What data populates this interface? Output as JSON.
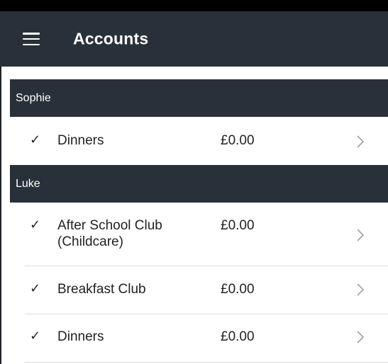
{
  "app_bar": {
    "title": "Accounts",
    "menu_icon": "hamburger-menu-icon",
    "background": "#283139"
  },
  "groups": [
    {
      "name": "Sophie",
      "accounts": [
        {
          "check": "✓",
          "name": "Dinners",
          "amount": "£0.00"
        }
      ]
    },
    {
      "name": "Luke",
      "accounts": [
        {
          "check": "✓",
          "name": "After School Club",
          "name_line2": "(Childcare)",
          "amount": "£0.00"
        },
        {
          "check": "✓",
          "name": "Breakfast Club",
          "amount": "£0.00"
        },
        {
          "check": "✓",
          "name": "Dinners",
          "amount": "£0.00"
        }
      ]
    }
  ],
  "colors": {
    "header": "#283139",
    "text": "#222222",
    "divider": "#dcdcdc",
    "chevron": "#9e9e9e"
  }
}
